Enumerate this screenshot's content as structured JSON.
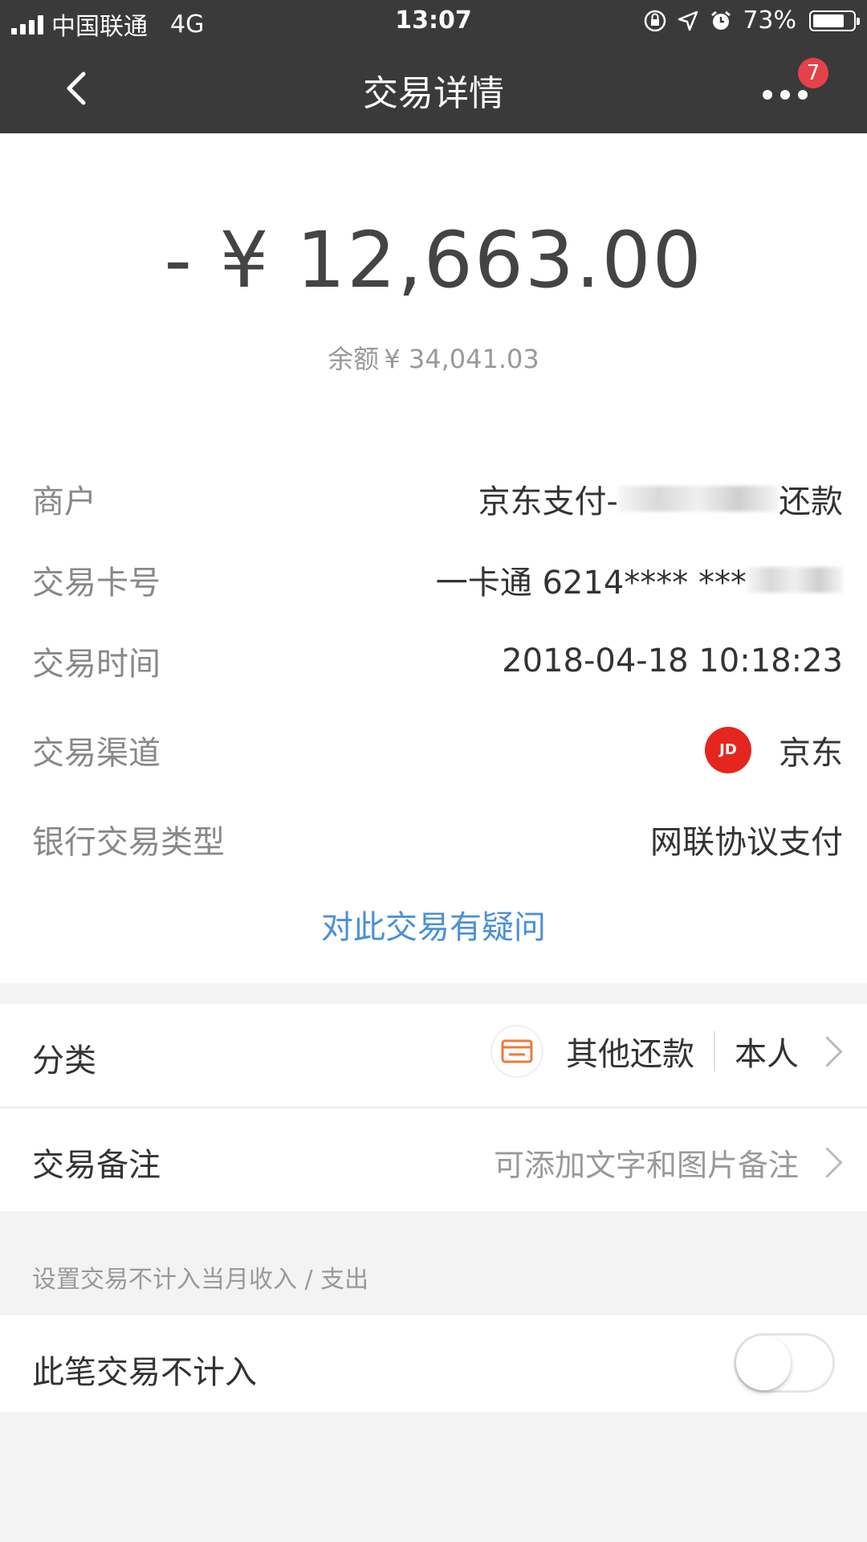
{
  "status_bar": {
    "carrier": "中国联通",
    "network": "4G",
    "time": "13:07",
    "battery": "73%"
  },
  "nav": {
    "title": "交易详情",
    "badge_count": "7"
  },
  "amount": {
    "value": "- ¥ 12,663.00",
    "balance_label": "余额",
    "balance_value": "¥ 34,041.03"
  },
  "details": {
    "merchant_label": "商户",
    "merchant_value_prefix": "京东支付-",
    "merchant_value_suffix": "还款",
    "card_label": "交易卡号",
    "card_value": "一卡通 6214**** ***",
    "time_label": "交易时间",
    "time_value": "2018-04-18 10:18:23",
    "channel_label": "交易渠道",
    "channel_logo_text": "JD",
    "channel_value": "京东",
    "type_label": "银行交易类型",
    "type_value": "网联协议支付",
    "doubt_link": "对此交易有疑问"
  },
  "category": {
    "label": "分类",
    "value": "其他还款",
    "person": "本人"
  },
  "note": {
    "label": "交易备注",
    "placeholder": "可添加文字和图片备注"
  },
  "exclude": {
    "hint": "设置交易不计入当月收入 / 支出",
    "label": "此笔交易不计入",
    "enabled": false
  },
  "colors": {
    "topbar": "#3a3a3a",
    "link": "#4a90d9",
    "badge": "#e5414b",
    "jd_red": "#e4261f",
    "category_icon": "#f07a3a"
  }
}
